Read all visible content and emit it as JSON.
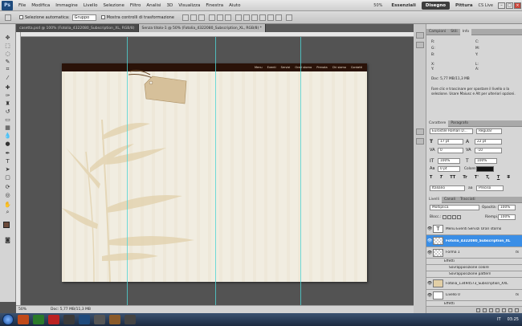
{
  "app": {
    "logo": "Ps"
  },
  "menu": [
    "File",
    "Modifica",
    "Immagine",
    "Livello",
    "Selezione",
    "Filtro",
    "Analisi",
    "3D",
    "Visualizza",
    "Finestra",
    "Aiuto"
  ],
  "menu_right": {
    "zoom": "50%",
    "workspaces": [
      "Essenziali",
      "Disegno",
      "Pittura"
    ],
    "active_workspace": "Disegno",
    "cslive": "CS Live"
  },
  "options": {
    "auto_select_label": "Selezione automatica:",
    "auto_select_value": "Gruppo",
    "show_transform_label": "Mostra controlli di trasformazione"
  },
  "tabs": [
    {
      "label": "casetta.psd @ 100% (Fotolia_4322080_Subscription_XL, RGB/8)"
    },
    {
      "label": "Senza titolo-1 @ 50% (Fotolia_4322080_Subscription_XL, RGB/8) *"
    }
  ],
  "site_nav": [
    "Menu",
    "Eventi",
    "Servizi",
    "Orari storno",
    "Prenota",
    "Chi siamo",
    "Contatti"
  ],
  "status": {
    "zoom": "50%",
    "doc": "Doc: 5,77 MB/11,3 MB"
  },
  "info_panel": {
    "tabs": [
      "Campioni",
      "Stili",
      "Info"
    ],
    "doc": "Doc: 5,77 MB/11,3 MB",
    "hint": "Fare clic e trascinare per spostare il livello o la selezione. Usare Maiusc e Alt per ulteriori opzioni."
  },
  "char_panel": {
    "tabs": [
      "Carattere",
      "Paragrafo"
    ],
    "font": "Eurostile Roman D...",
    "style": "Regular",
    "size": "17 pt",
    "leading": "22 pt",
    "kerning": "0",
    "tracking": "-10",
    "vscale": "100%",
    "hscale": "100%",
    "baseline": "0 pt",
    "color_label": "Colore:",
    "language": "Italiano",
    "aa": "Preciso",
    "aa_code": "aa",
    "tt_buttons": [
      "T",
      "T",
      "TT",
      "Tr",
      "T'",
      "T,",
      "T",
      "T"
    ]
  },
  "layers_panel": {
    "tabs": [
      "Livelli",
      "Canali",
      "Tracciati"
    ],
    "blend": "Moltiplica",
    "opacity_label": "Opacità:",
    "opacity": "100%",
    "lock_label": "Blocc.:",
    "fill_label": "Riempi.:",
    "fill": "100%",
    "layers": [
      {
        "name": "Menu    Eventi    Servizi    Orari storno",
        "type": "text"
      },
      {
        "name": "Fotolia_4322080_Subscription_XL",
        "type": "image",
        "selected": true
      },
      {
        "name": "Forma 1",
        "type": "shape",
        "fx": "fx"
      },
      {
        "name": "Effetti",
        "type": "sub"
      },
      {
        "name": "Sovrapposizione colore",
        "type": "sub2"
      },
      {
        "name": "Sovrapposizione pattern",
        "type": "sub2"
      },
      {
        "name": "Fotolia_13494573_Subscription_XXL",
        "type": "image"
      },
      {
        "name": "Livello 0",
        "type": "image",
        "fx": "fx"
      },
      {
        "name": "Effetti",
        "type": "sub"
      }
    ]
  },
  "taskbar": {
    "clock": "03:25",
    "lang": "IT"
  },
  "colors": {
    "accent": "#3a8ee6",
    "site_header": "#2a1208",
    "canvas_bg": "#f1ede1",
    "guide": "#4fd4d4"
  }
}
